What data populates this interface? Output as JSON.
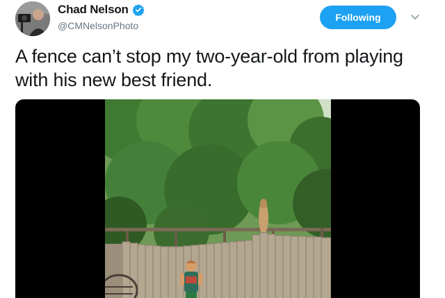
{
  "tweet": {
    "author": {
      "display_name": "Chad Nelson",
      "handle": "@CMNelsonPhoto",
      "verified": true,
      "avatar_icon": "camera-operator-avatar"
    },
    "follow_button_label": "Following",
    "menu_icon": "chevron-down-icon",
    "text": "A fence can’t stop my two-year-old from playing with his new best friend.",
    "media": {
      "type": "video",
      "scene": "child in backyard, dog peeking over wooden fence"
    }
  },
  "colors": {
    "accent": "#1da1f2",
    "text_primary": "#14171a",
    "text_secondary": "#657786"
  }
}
